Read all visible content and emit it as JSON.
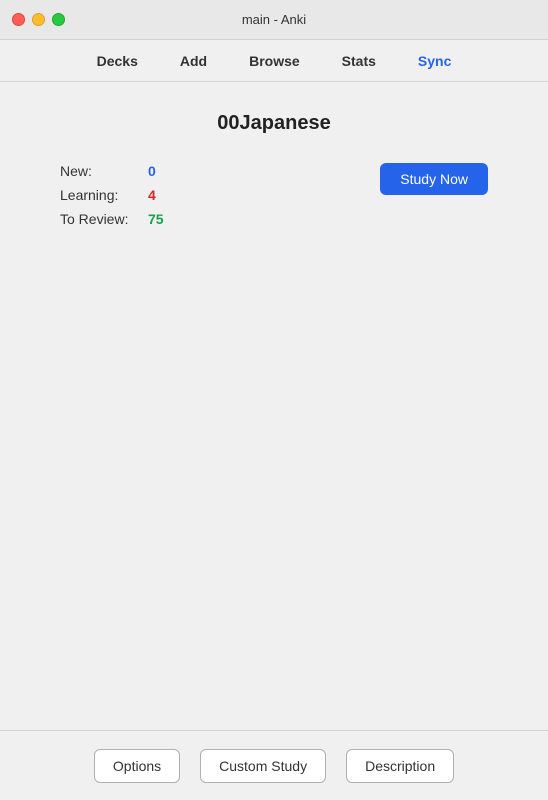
{
  "titleBar": {
    "title": "main - Anki"
  },
  "nav": {
    "items": [
      {
        "id": "decks",
        "label": "Decks",
        "active": false
      },
      {
        "id": "add",
        "label": "Add",
        "active": false
      },
      {
        "id": "browse",
        "label": "Browse",
        "active": false
      },
      {
        "id": "stats",
        "label": "Stats",
        "active": false
      },
      {
        "id": "sync",
        "label": "Sync",
        "active": true
      }
    ]
  },
  "main": {
    "deckTitle": "00Japanese",
    "stats": {
      "new": {
        "label": "New:",
        "value": "0",
        "colorClass": "blue"
      },
      "learning": {
        "label": "Learning:",
        "value": "4",
        "colorClass": "red"
      },
      "toReview": {
        "label": "To Review:",
        "value": "75",
        "colorClass": "green"
      }
    },
    "studyNowButton": "Study Now"
  },
  "footer": {
    "optionsButton": "Options",
    "customStudyButton": "Custom Study",
    "descriptionButton": "Description"
  },
  "trafficLights": {
    "closeTitle": "close",
    "minimizeTitle": "minimize",
    "maximizeTitle": "maximize"
  }
}
